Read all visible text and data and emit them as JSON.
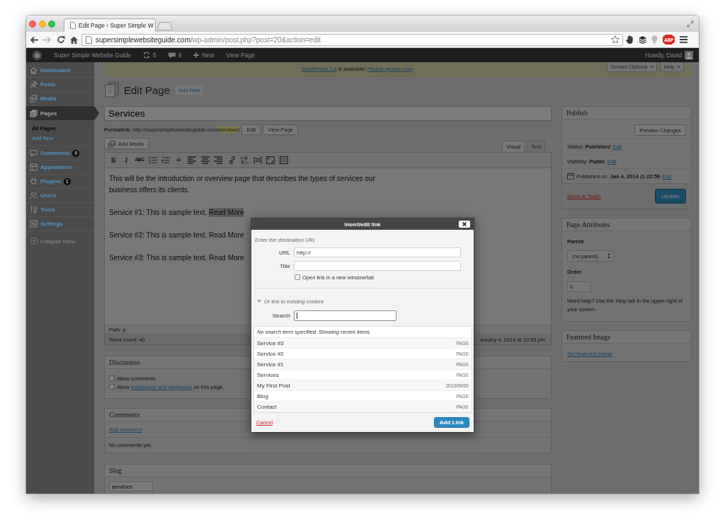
{
  "browser": {
    "tab_title": "Edit Page ‹ Super Simple W",
    "forward_disabled": true,
    "url_domain": "supersimplewebsiteguide.com",
    "url_path": "/wp-admin/post.php?post=20&action=edit",
    "extension_badge": "ABP"
  },
  "admin_bar": {
    "site_name": "Super Simple Website Guide",
    "updates": "5",
    "comments": "9",
    "new_label": "New",
    "view_label": "View Page",
    "greeting": "Howdy, David"
  },
  "sidebar": {
    "items": [
      {
        "kind": "dashboard",
        "label": "Dashboard",
        "selected": false
      },
      {
        "kind": "posts",
        "label": "Posts",
        "selected": false
      },
      {
        "kind": "media",
        "label": "Media",
        "selected": false
      },
      {
        "kind": "pages",
        "label": "Pages",
        "selected": true,
        "children": [
          {
            "label": "All Pages",
            "selected": true
          },
          {
            "label": "Add New",
            "selected": false
          }
        ]
      },
      {
        "kind": "comments",
        "label": "Comments",
        "selected": false,
        "badge": "0"
      },
      {
        "kind": "appearance",
        "label": "Appearance",
        "selected": false
      },
      {
        "kind": "plugins",
        "label": "Plugins",
        "selected": false,
        "badge": "1"
      },
      {
        "kind": "users",
        "label": "Users",
        "selected": false
      },
      {
        "kind": "tools",
        "label": "Tools",
        "selected": false
      },
      {
        "kind": "settings",
        "label": "Settings",
        "selected": false
      }
    ],
    "collapse_label": "Collapse menu"
  },
  "notice": {
    "parts": [
      {
        "kind": "link",
        "text": "WordPress 3.8"
      },
      {
        "kind": "text",
        "text": " is available! "
      },
      {
        "kind": "link",
        "text": "Please update now"
      },
      {
        "kind": "text",
        "text": "."
      }
    ]
  },
  "screen_tabs": [
    {
      "label": "Screen Options"
    },
    {
      "label": "Help"
    }
  ],
  "heading": {
    "title": "Edit Page",
    "add_new": "Add New"
  },
  "title_field": {
    "value": "Services"
  },
  "permalink": {
    "parts": [
      {
        "kind": "label",
        "text": "Permalink:"
      },
      {
        "kind": "text",
        "text": " http://supersimplewebsiteguide.com/"
      },
      {
        "kind": "highlight",
        "text": "services"
      },
      {
        "kind": "text",
        "text": "/"
      }
    ],
    "buttons": [
      "Edit",
      "View Page"
    ]
  },
  "add_media": "Add Media",
  "editor": {
    "tabs": [
      {
        "label": "Visual",
        "selected": true
      },
      {
        "label": "Text",
        "selected": false
      }
    ],
    "toolbar": [
      {
        "kind": "bold",
        "glyph": "B"
      },
      {
        "kind": "italic",
        "glyph": "I"
      },
      {
        "kind": "strikethrough",
        "glyph": "ABC"
      },
      {
        "kind": "bullet-list"
      },
      {
        "kind": "numbered-list"
      },
      {
        "kind": "blockquote",
        "glyph": "“"
      },
      {
        "kind": "align-left"
      },
      {
        "kind": "align-center"
      },
      {
        "kind": "align-right"
      },
      {
        "kind": "link"
      },
      {
        "kind": "unlink"
      },
      {
        "kind": "read-more"
      },
      {
        "kind": "fullscreen"
      },
      {
        "kind": "toolbar-toggle"
      }
    ],
    "paragraphs": [
      {
        "text": "This will be the introduction or overview page that describes the types of services our business offers its clients."
      },
      {
        "text": "Service #1: This is sample text. ",
        "tail": "Read More",
        "selected": true
      },
      {
        "text": "Service #2: This is sample text. ",
        "tail": "Read More",
        "selected": false
      },
      {
        "text": "Service #3: This is sample text. ",
        "tail": "Read More",
        "selected": false
      }
    ],
    "path": "Path: p",
    "word_count": "Word count: 40",
    "last_edited": "anuary 4, 2014 at 10:59 pm"
  },
  "publish": {
    "title": "Publish",
    "preview_button": "Preview Changes",
    "rows": [
      {
        "kind": "status",
        "text": "Status: **Published**",
        "edit": "Edit"
      },
      {
        "kind": "status",
        "text": "Visibility: **Public**",
        "edit": "Edit"
      },
      {
        "kind": "date",
        "text": "Published on: **Jan 4, 2014 @ 22:59**",
        "edit": "Edit"
      }
    ],
    "trash_link": "Move to Trash",
    "update_button": "Update"
  },
  "page_attributes": {
    "title": "Page Attributes",
    "parent_label": "Parent",
    "parent_value": "(no parent)",
    "order_label": "Order",
    "order_value": "0",
    "help": "Need help? Use the Help tab in the upper right of your screen."
  },
  "featured_image": {
    "title": "Featured Image",
    "link": "Set featured image"
  },
  "discussion": {
    "title": "Discussion",
    "options": [
      {
        "checked": false,
        "parts": [
          {
            "kind": "text",
            "text": "Allow comments."
          }
        ]
      },
      {
        "checked": false,
        "parts": [
          {
            "kind": "text",
            "text": "Allow "
          },
          {
            "kind": "link",
            "text": "trackbacks and pingbacks"
          },
          {
            "kind": "text",
            "text": " on this page."
          }
        ]
      }
    ]
  },
  "comments": {
    "title": "Comments",
    "add_link": "Add comment",
    "empty": "No comments yet."
  },
  "slug": {
    "title": "Slug",
    "value": "services"
  },
  "link_dialog": {
    "title": "Insert/edit link",
    "intro": "Enter the destination URL",
    "fields": [
      {
        "label": "URL",
        "value": "http://"
      },
      {
        "label": "Title"
      }
    ],
    "new_tab": {
      "label": "Open link in a new window/tab",
      "checked": false
    },
    "existing": {
      "label": "Or link to existing content",
      "expanded": true
    },
    "search": {
      "label": "Search",
      "focused": true
    },
    "results": {
      "notice": "No search term specified. Showing recent items.",
      "items": [
        {
          "title": "Service #3",
          "info": "PAGE",
          "selected": false
        },
        {
          "title": "Service #2",
          "info": "PAGE",
          "selected": false
        },
        {
          "title": "Service #1",
          "info": "PAGE",
          "selected": false
        },
        {
          "title": "Services",
          "info": "PAGE",
          "selected": false
        },
        {
          "title": "My First Post",
          "info": "2013/09/20",
          "selected": false
        },
        {
          "title": "Blog",
          "info": "PAGE",
          "selected": false
        },
        {
          "title": "Contact",
          "info": "PAGE",
          "selected": false
        }
      ]
    },
    "cancel": "Cancel",
    "submit": "Add Link"
  }
}
